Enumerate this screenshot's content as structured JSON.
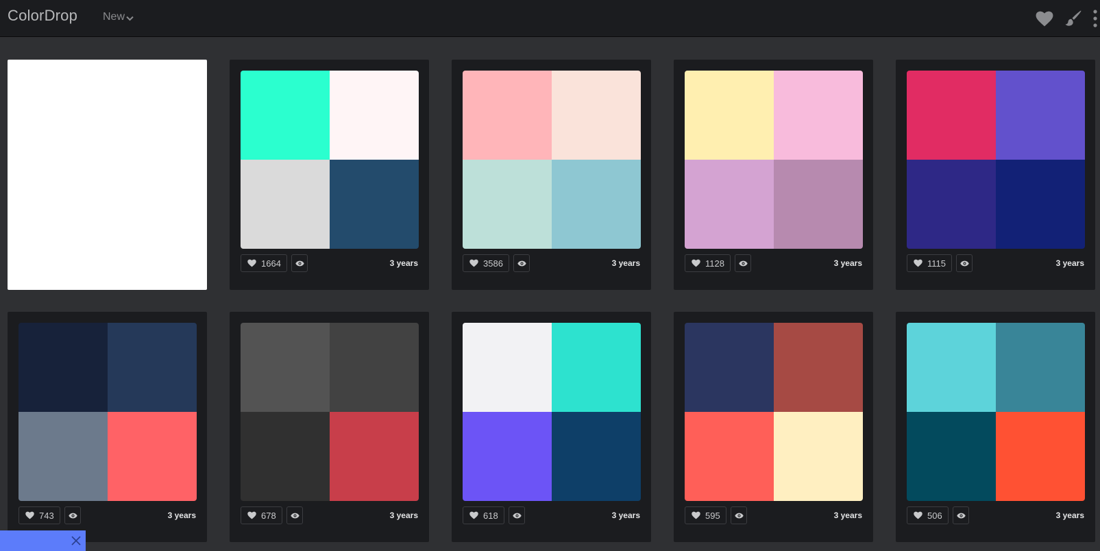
{
  "header": {
    "brand": "ColorDrop",
    "nav_label": "New",
    "icons": [
      "heart-icon",
      "brush-icon",
      "more-vertical-icon"
    ]
  },
  "palettes": [
    {
      "likes": "1664",
      "age": "3 years",
      "colors": [
        "#2bffcf",
        "#fff5f6",
        "#dadada",
        "#234b6c"
      ]
    },
    {
      "likes": "3586",
      "age": "3 years",
      "colors": [
        "#ffb5b9",
        "#fae3da",
        "#bde0d9",
        "#8ec7d2"
      ]
    },
    {
      "likes": "1128",
      "age": "3 years",
      "colors": [
        "#ffefb0",
        "#f8bbdc",
        "#d4a3d2",
        "#b78aaf"
      ]
    },
    {
      "likes": "1115",
      "age": "3 years",
      "colors": [
        "#e12c63",
        "#6251cc",
        "#2e2886",
        "#122176"
      ]
    },
    {
      "likes": "743",
      "age": "3 years",
      "colors": [
        "#17223a",
        "#253959",
        "#6c7a8c",
        "#ff6266"
      ]
    },
    {
      "likes": "678",
      "age": "3 years",
      "colors": [
        "#535353",
        "#424242",
        "#303030",
        "#c83e4a"
      ]
    },
    {
      "likes": "618",
      "age": "3 years",
      "colors": [
        "#f2f2f4",
        "#2de2cf",
        "#6c54f6",
        "#0e3f68"
      ]
    },
    {
      "likes": "595",
      "age": "3 years",
      "colors": [
        "#2b3660",
        "#a64a44",
        "#ff5f58",
        "#ffefc1"
      ]
    },
    {
      "likes": "506",
      "age": "3 years",
      "colors": [
        "#5dd3da",
        "#398598",
        "#034a5d",
        "#ff5133"
      ]
    }
  ],
  "colors": {
    "topbar_bg": "#1b1c1f",
    "page_bg": "#2f3033",
    "card_bg": "#1b1c1f",
    "toast_bg": "#5c7cfa"
  }
}
